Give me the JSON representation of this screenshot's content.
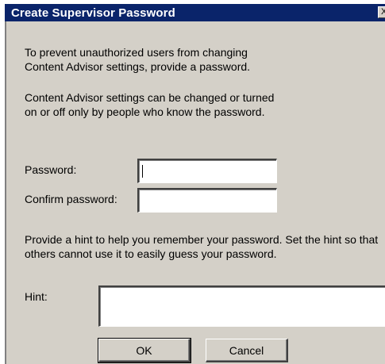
{
  "dialog": {
    "title": "Create Supervisor Password",
    "close_glyph": "X",
    "intro": "To prevent unauthorized users from changing Content Advisor settings, provide a password.",
    "info": "Content Advisor settings can be changed or turned on or off only by people who know the password.",
    "password_label": "Password:",
    "password_value": "",
    "confirm_label": "Confirm password:",
    "confirm_value": "",
    "hint_instructions": "Provide a hint to help you remember your password. Set the hint so that others cannot use it to easily guess your password.",
    "hint_label": "Hint:",
    "hint_value": "",
    "ok_label": "OK",
    "cancel_label": "Cancel"
  },
  "colors": {
    "title_bar": "#0a246a",
    "dialog_face": "#d4d0c8"
  }
}
